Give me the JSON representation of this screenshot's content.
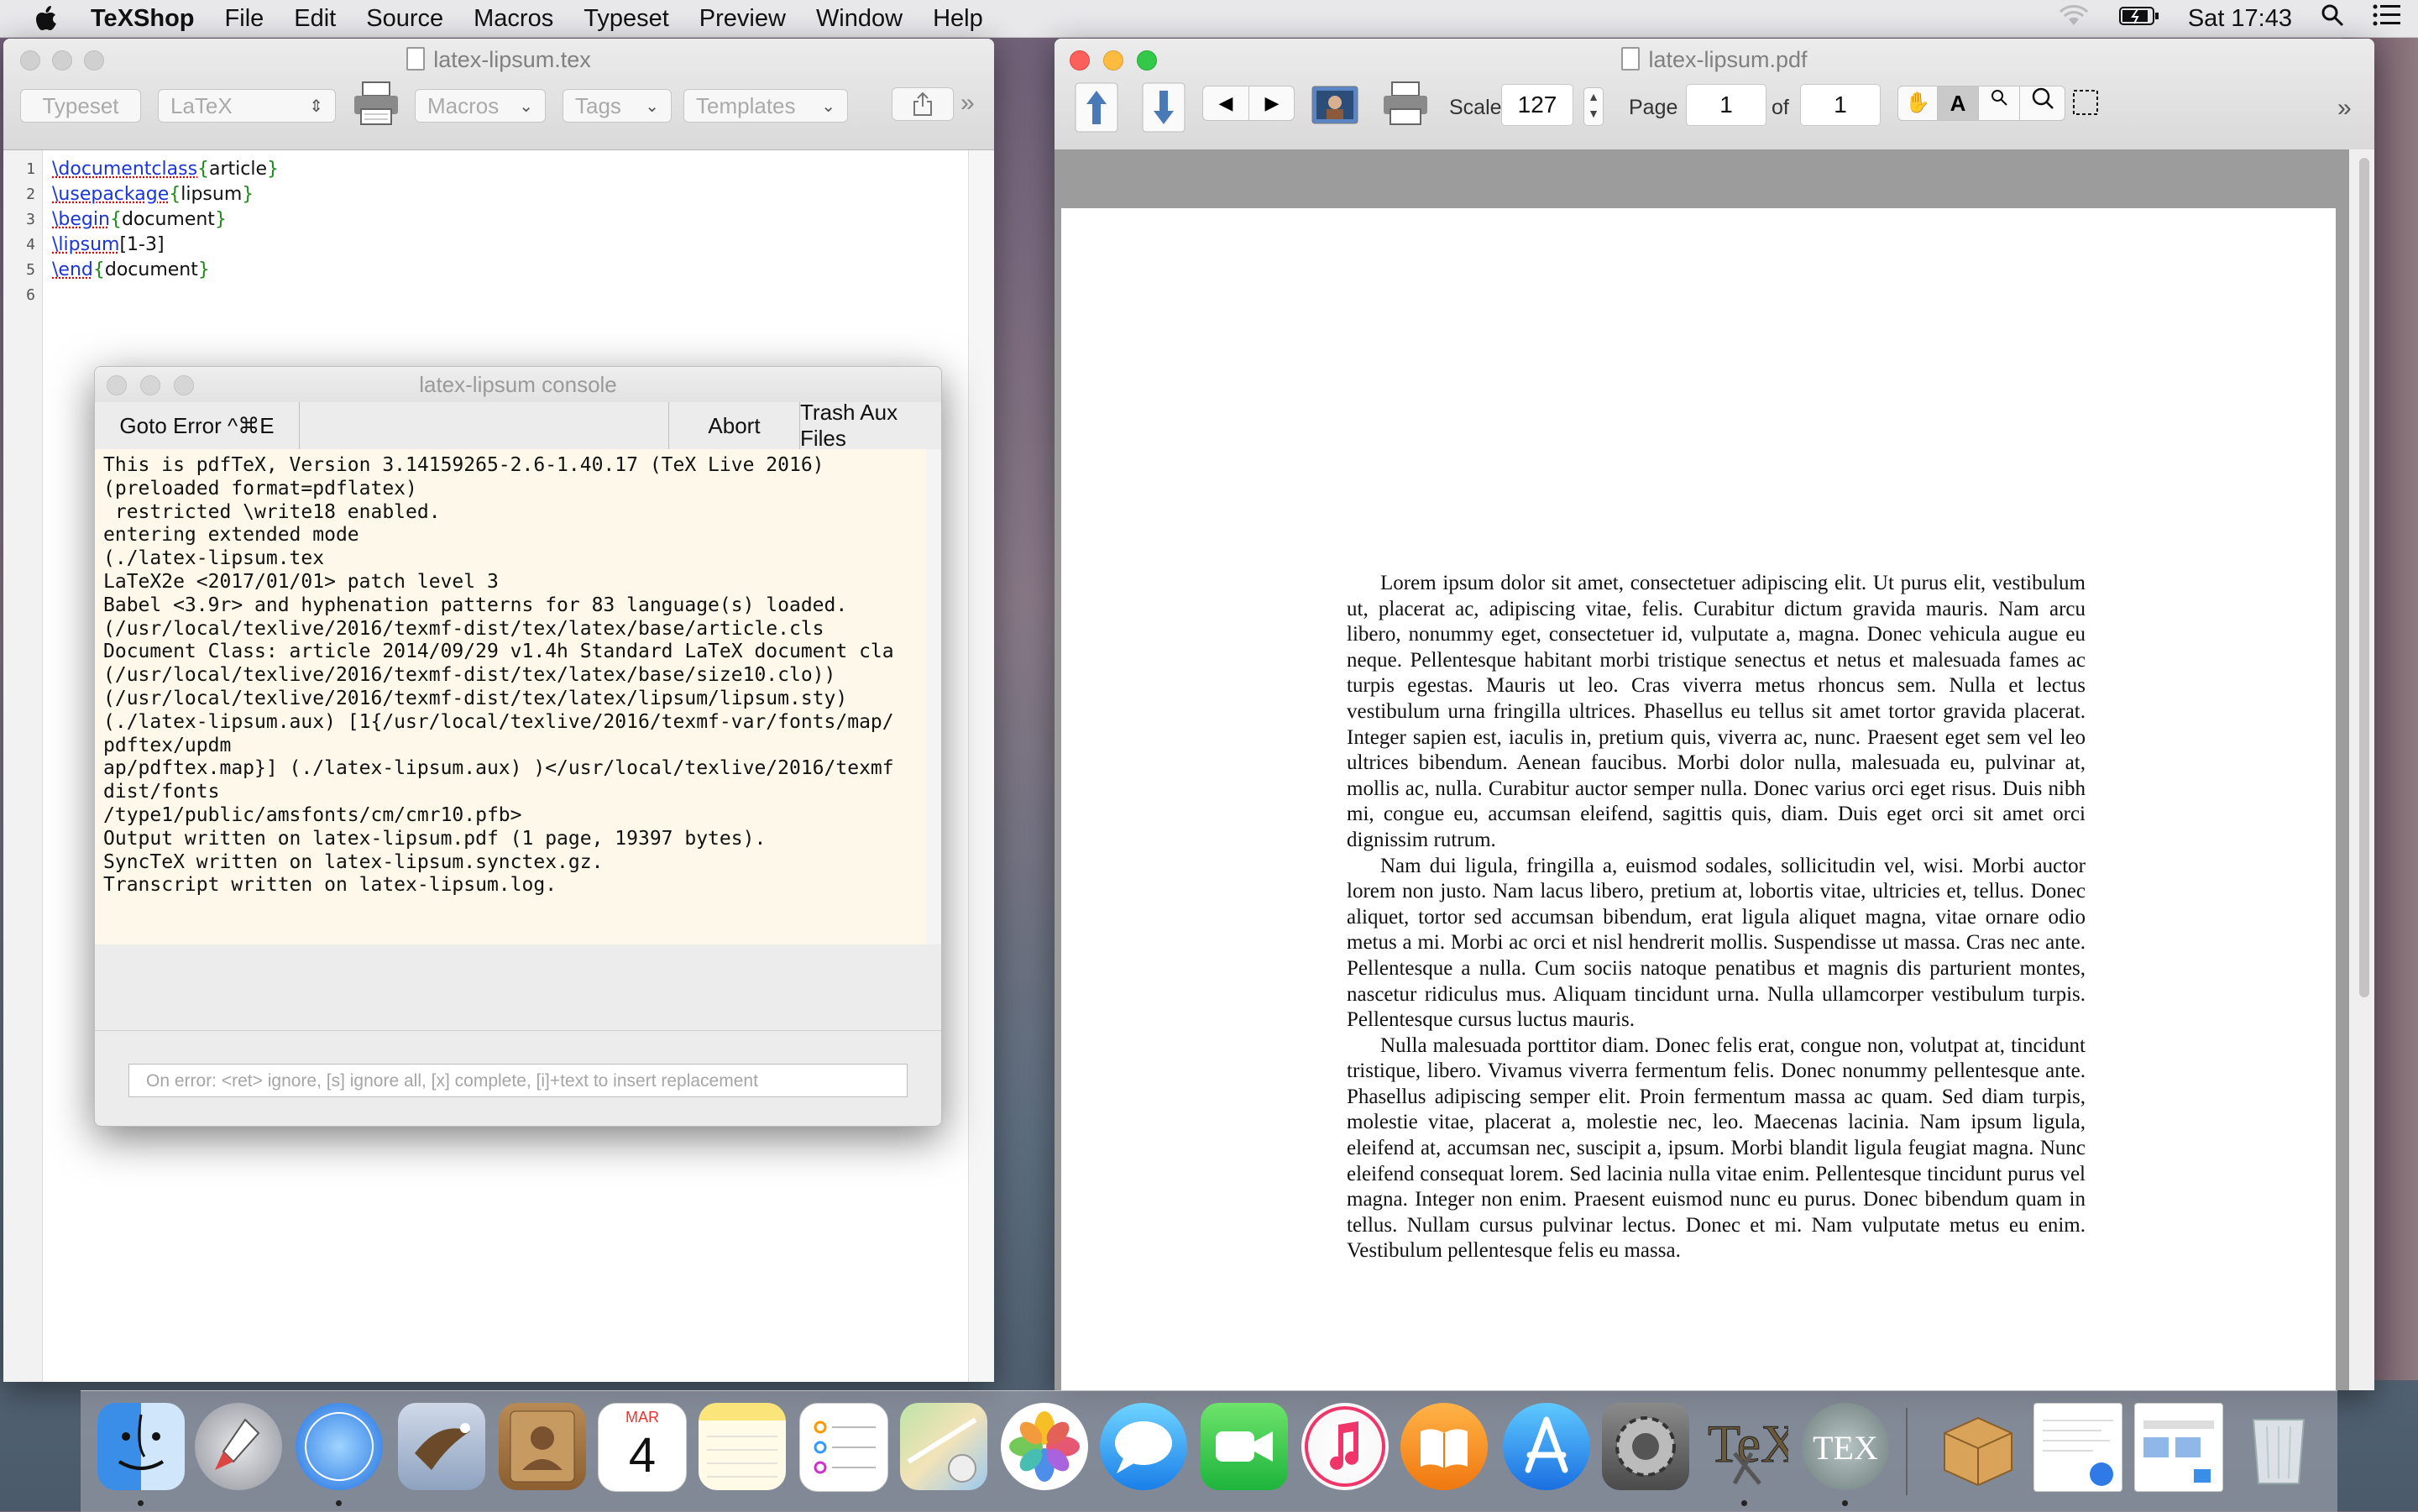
{
  "menubar": {
    "app": "TeXShop",
    "items": [
      "File",
      "Edit",
      "Source",
      "Macros",
      "Typeset",
      "Preview",
      "Window",
      "Help"
    ],
    "clock": "Sat 17:43"
  },
  "editor": {
    "title": "latex-lipsum.tex",
    "toolbar": {
      "typeset": "Typeset",
      "engine": "LaTeX",
      "macros": "Macros",
      "tags": "Tags",
      "templates": "Templates",
      "more": "»"
    },
    "line_numbers": [
      "1",
      "2",
      "3",
      "4",
      "5",
      "6"
    ],
    "lines": [
      {
        "cmd": "\\documentclass",
        "open": "{",
        "arg": "article",
        "close": "}",
        "extra": ""
      },
      {
        "cmd": "\\usepackage",
        "open": "{",
        "arg": "lipsum",
        "close": "}",
        "extra": ""
      },
      {
        "cmd": "\\begin",
        "open": "{",
        "arg": "document",
        "close": "}",
        "extra": ""
      },
      {
        "cmd": "\\lipsum",
        "open": "",
        "arg": "[1-3]",
        "close": "",
        "extra": ""
      },
      {
        "cmd": "\\end",
        "open": "{",
        "arg": "document",
        "close": "}",
        "extra": ""
      }
    ]
  },
  "console": {
    "title": "latex-lipsum console",
    "goto_error": "Goto Error ^⌘E",
    "abort": "Abort",
    "trash": "Trash Aux Files",
    "log": "This is pdfTeX, Version 3.14159265-2.6-1.40.17 (TeX Live 2016)\n(preloaded format=pdflatex)\n restricted \\write18 enabled.\nentering extended mode\n(./latex-lipsum.tex\nLaTeX2e <2017/01/01> patch level 3\nBabel <3.9r> and hyphenation patterns for 83 language(s) loaded.\n(/usr/local/texlive/2016/texmf-dist/tex/latex/base/article.cls\nDocument Class: article 2014/09/29 v1.4h Standard LaTeX document cla\n(/usr/local/texlive/2016/texmf-dist/tex/latex/base/size10.clo))\n(/usr/local/texlive/2016/texmf-dist/tex/latex/lipsum/lipsum.sty)\n(./latex-lipsum.aux) [1{/usr/local/texlive/2016/texmf-var/fonts/map/\npdftex/updm\nap/pdftex.map}] (./latex-lipsum.aux) )</usr/local/texlive/2016/texmf\ndist/fonts\n/type1/public/amsfonts/cm/cmr10.pfb>\nOutput written on latex-lipsum.pdf (1 page, 19397 bytes).\nSyncTeX written on latex-lipsum.synctex.gz.\nTranscript written on latex-lipsum.log.",
    "input_placeholder": "On error: <ret> ignore, [s] ignore all, [x] complete, [i]+text to insert replacement"
  },
  "pdf": {
    "title": "latex-lipsum.pdf",
    "scale_label": "Scale",
    "scale_value": "127",
    "page_label": "Page",
    "page_value": "1",
    "of_label": "of",
    "page_total": "1",
    "more": "»",
    "paragraphs": [
      "Lorem ipsum dolor sit amet, consectetuer adipiscing elit. Ut purus elit, vestibulum ut, placerat ac, adipiscing vitae, felis. Curabitur dictum gravida mauris. Nam arcu libero, nonummy eget, consectetuer id, vulputate a, magna. Donec vehicula augue eu neque. Pellentesque habitant morbi tristique senectus et netus et malesuada fames ac turpis egestas. Mauris ut leo. Cras viverra metus rhoncus sem. Nulla et lectus vestibulum urna fringilla ultrices. Phasellus eu tellus sit amet tortor gravida placerat. Integer sapien est, iaculis in, pretium quis, viverra ac, nunc. Praesent eget sem vel leo ultrices bibendum. Aenean faucibus. Morbi dolor nulla, malesuada eu, pulvinar at, mollis ac, nulla. Curabitur auctor semper nulla. Donec varius orci eget risus. Duis nibh mi, congue eu, accumsan eleifend, sagittis quis, diam. Duis eget orci sit amet orci dignissim rutrum.",
      "Nam dui ligula, fringilla a, euismod sodales, sollicitudin vel, wisi. Morbi auctor lorem non justo. Nam lacus libero, pretium at, lobortis vitae, ultricies et, tellus. Donec aliquet, tortor sed accumsan bibendum, erat ligula aliquet magna, vitae ornare odio metus a mi. Morbi ac orci et nisl hendrerit mollis. Suspendisse ut massa. Cras nec ante. Pellentesque a nulla. Cum sociis natoque penatibus et magnis dis parturient montes, nascetur ridiculus mus. Aliquam tincidunt urna. Nulla ullamcorper vestibulum turpis. Pellentesque cursus luctus mauris.",
      "Nulla malesuada porttitor diam. Donec felis erat, congue non, volutpat at, tincidunt tristique, libero. Vivamus viverra fermentum felis. Donec nonummy pellentesque ante. Phasellus adipiscing semper elit. Proin fermentum massa ac quam. Sed diam turpis, molestie vitae, placerat a, molestie nec, leo. Maecenas lacinia. Nam ipsum ligula, eleifend at, accumsan nec, suscipit a, ipsum. Morbi blandit ligula feugiat magna. Nunc eleifend consequat lorem. Sed lacinia nulla vitae enim. Pellentesque tincidunt purus vel magna. Integer non enim. Praesent euismod nunc eu purus. Donec bibendum quam in tellus. Nullam cursus pulvinar lectus. Donec et mi. Nam vulputate metus eu enim. Vestibulum pellentesque felis eu massa."
    ]
  },
  "dock": {
    "calendar_month": "MAR",
    "calendar_day": "4",
    "tex_label": "TEX",
    "apps": [
      "finder-icon",
      "launchpad-icon",
      "safari-icon",
      "mail-icon",
      "contacts-icon",
      "calendar-icon",
      "notes-icon",
      "reminders-icon",
      "maps-icon",
      "photos-icon",
      "messages-icon",
      "facetime-icon",
      "itunes-icon",
      "ibooks-icon",
      "app-store-icon",
      "system-preferences-icon",
      "texshop-icon",
      "tex-live-utility-icon"
    ]
  },
  "colors": {
    "close": "#fc605c",
    "minimize": "#fdbc40",
    "zoom": "#34c84a",
    "console_bg": "#fdf8ea",
    "tex_command": "#1a35d9",
    "tex_brace": "#1a8a1a"
  }
}
